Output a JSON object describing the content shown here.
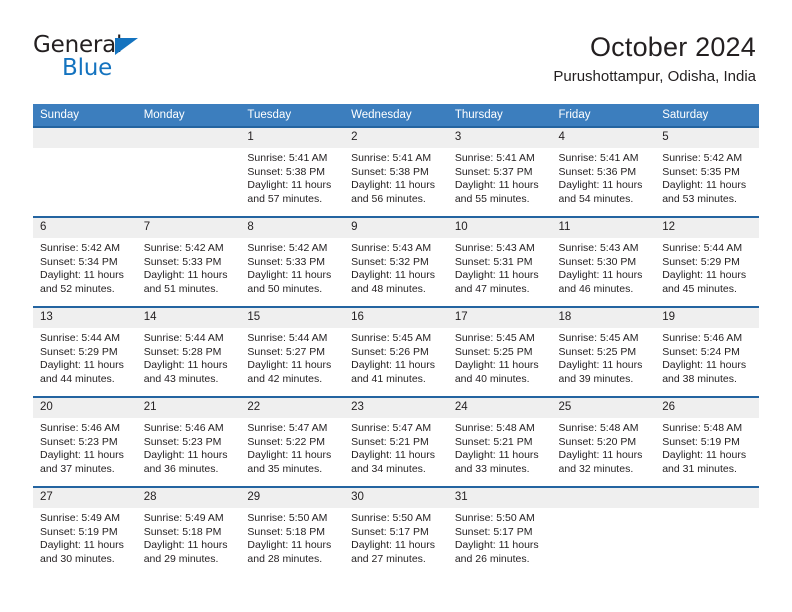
{
  "brand": {
    "name_top": "General",
    "name_bottom": "Blue"
  },
  "header": {
    "title": "October 2024",
    "location": "Purushottampur, Odisha, India"
  },
  "colors": {
    "header_blue": "#3c7ebe",
    "row_divider_blue": "#2464a0",
    "daynum_band": "#efefef",
    "brand_blue": "#1473bf",
    "text": "#231f20"
  },
  "calendar": {
    "weekday_headers": [
      "Sunday",
      "Monday",
      "Tuesday",
      "Wednesday",
      "Thursday",
      "Friday",
      "Saturday"
    ],
    "labels": {
      "sunrise_prefix": "Sunrise:",
      "sunset_prefix": "Sunset:",
      "daylight_prefix": "Daylight:"
    },
    "weeks": [
      [
        {
          "day": "",
          "sunrise": "",
          "sunset": "",
          "daylight_line1": "",
          "daylight_line2": ""
        },
        {
          "day": "",
          "sunrise": "",
          "sunset": "",
          "daylight_line1": "",
          "daylight_line2": ""
        },
        {
          "day": "1",
          "sunrise": "Sunrise: 5:41 AM",
          "sunset": "Sunset: 5:38 PM",
          "daylight_line1": "Daylight: 11 hours",
          "daylight_line2": "and 57 minutes."
        },
        {
          "day": "2",
          "sunrise": "Sunrise: 5:41 AM",
          "sunset": "Sunset: 5:38 PM",
          "daylight_line1": "Daylight: 11 hours",
          "daylight_line2": "and 56 minutes."
        },
        {
          "day": "3",
          "sunrise": "Sunrise: 5:41 AM",
          "sunset": "Sunset: 5:37 PM",
          "daylight_line1": "Daylight: 11 hours",
          "daylight_line2": "and 55 minutes."
        },
        {
          "day": "4",
          "sunrise": "Sunrise: 5:41 AM",
          "sunset": "Sunset: 5:36 PM",
          "daylight_line1": "Daylight: 11 hours",
          "daylight_line2": "and 54 minutes."
        },
        {
          "day": "5",
          "sunrise": "Sunrise: 5:42 AM",
          "sunset": "Sunset: 5:35 PM",
          "daylight_line1": "Daylight: 11 hours",
          "daylight_line2": "and 53 minutes."
        }
      ],
      [
        {
          "day": "6",
          "sunrise": "Sunrise: 5:42 AM",
          "sunset": "Sunset: 5:34 PM",
          "daylight_line1": "Daylight: 11 hours",
          "daylight_line2": "and 52 minutes."
        },
        {
          "day": "7",
          "sunrise": "Sunrise: 5:42 AM",
          "sunset": "Sunset: 5:33 PM",
          "daylight_line1": "Daylight: 11 hours",
          "daylight_line2": "and 51 minutes."
        },
        {
          "day": "8",
          "sunrise": "Sunrise: 5:42 AM",
          "sunset": "Sunset: 5:33 PM",
          "daylight_line1": "Daylight: 11 hours",
          "daylight_line2": "and 50 minutes."
        },
        {
          "day": "9",
          "sunrise": "Sunrise: 5:43 AM",
          "sunset": "Sunset: 5:32 PM",
          "daylight_line1": "Daylight: 11 hours",
          "daylight_line2": "and 48 minutes."
        },
        {
          "day": "10",
          "sunrise": "Sunrise: 5:43 AM",
          "sunset": "Sunset: 5:31 PM",
          "daylight_line1": "Daylight: 11 hours",
          "daylight_line2": "and 47 minutes."
        },
        {
          "day": "11",
          "sunrise": "Sunrise: 5:43 AM",
          "sunset": "Sunset: 5:30 PM",
          "daylight_line1": "Daylight: 11 hours",
          "daylight_line2": "and 46 minutes."
        },
        {
          "day": "12",
          "sunrise": "Sunrise: 5:44 AM",
          "sunset": "Sunset: 5:29 PM",
          "daylight_line1": "Daylight: 11 hours",
          "daylight_line2": "and 45 minutes."
        }
      ],
      [
        {
          "day": "13",
          "sunrise": "Sunrise: 5:44 AM",
          "sunset": "Sunset: 5:29 PM",
          "daylight_line1": "Daylight: 11 hours",
          "daylight_line2": "and 44 minutes."
        },
        {
          "day": "14",
          "sunrise": "Sunrise: 5:44 AM",
          "sunset": "Sunset: 5:28 PM",
          "daylight_line1": "Daylight: 11 hours",
          "daylight_line2": "and 43 minutes."
        },
        {
          "day": "15",
          "sunrise": "Sunrise: 5:44 AM",
          "sunset": "Sunset: 5:27 PM",
          "daylight_line1": "Daylight: 11 hours",
          "daylight_line2": "and 42 minutes."
        },
        {
          "day": "16",
          "sunrise": "Sunrise: 5:45 AM",
          "sunset": "Sunset: 5:26 PM",
          "daylight_line1": "Daylight: 11 hours",
          "daylight_line2": "and 41 minutes."
        },
        {
          "day": "17",
          "sunrise": "Sunrise: 5:45 AM",
          "sunset": "Sunset: 5:25 PM",
          "daylight_line1": "Daylight: 11 hours",
          "daylight_line2": "and 40 minutes."
        },
        {
          "day": "18",
          "sunrise": "Sunrise: 5:45 AM",
          "sunset": "Sunset: 5:25 PM",
          "daylight_line1": "Daylight: 11 hours",
          "daylight_line2": "and 39 minutes."
        },
        {
          "day": "19",
          "sunrise": "Sunrise: 5:46 AM",
          "sunset": "Sunset: 5:24 PM",
          "daylight_line1": "Daylight: 11 hours",
          "daylight_line2": "and 38 minutes."
        }
      ],
      [
        {
          "day": "20",
          "sunrise": "Sunrise: 5:46 AM",
          "sunset": "Sunset: 5:23 PM",
          "daylight_line1": "Daylight: 11 hours",
          "daylight_line2": "and 37 minutes."
        },
        {
          "day": "21",
          "sunrise": "Sunrise: 5:46 AM",
          "sunset": "Sunset: 5:23 PM",
          "daylight_line1": "Daylight: 11 hours",
          "daylight_line2": "and 36 minutes."
        },
        {
          "day": "22",
          "sunrise": "Sunrise: 5:47 AM",
          "sunset": "Sunset: 5:22 PM",
          "daylight_line1": "Daylight: 11 hours",
          "daylight_line2": "and 35 minutes."
        },
        {
          "day": "23",
          "sunrise": "Sunrise: 5:47 AM",
          "sunset": "Sunset: 5:21 PM",
          "daylight_line1": "Daylight: 11 hours",
          "daylight_line2": "and 34 minutes."
        },
        {
          "day": "24",
          "sunrise": "Sunrise: 5:48 AM",
          "sunset": "Sunset: 5:21 PM",
          "daylight_line1": "Daylight: 11 hours",
          "daylight_line2": "and 33 minutes."
        },
        {
          "day": "25",
          "sunrise": "Sunrise: 5:48 AM",
          "sunset": "Sunset: 5:20 PM",
          "daylight_line1": "Daylight: 11 hours",
          "daylight_line2": "and 32 minutes."
        },
        {
          "day": "26",
          "sunrise": "Sunrise: 5:48 AM",
          "sunset": "Sunset: 5:19 PM",
          "daylight_line1": "Daylight: 11 hours",
          "daylight_line2": "and 31 minutes."
        }
      ],
      [
        {
          "day": "27",
          "sunrise": "Sunrise: 5:49 AM",
          "sunset": "Sunset: 5:19 PM",
          "daylight_line1": "Daylight: 11 hours",
          "daylight_line2": "and 30 minutes."
        },
        {
          "day": "28",
          "sunrise": "Sunrise: 5:49 AM",
          "sunset": "Sunset: 5:18 PM",
          "daylight_line1": "Daylight: 11 hours",
          "daylight_line2": "and 29 minutes."
        },
        {
          "day": "29",
          "sunrise": "Sunrise: 5:50 AM",
          "sunset": "Sunset: 5:18 PM",
          "daylight_line1": "Daylight: 11 hours",
          "daylight_line2": "and 28 minutes."
        },
        {
          "day": "30",
          "sunrise": "Sunrise: 5:50 AM",
          "sunset": "Sunset: 5:17 PM",
          "daylight_line1": "Daylight: 11 hours",
          "daylight_line2": "and 27 minutes."
        },
        {
          "day": "31",
          "sunrise": "Sunrise: 5:50 AM",
          "sunset": "Sunset: 5:17 PM",
          "daylight_line1": "Daylight: 11 hours",
          "daylight_line2": "and 26 minutes."
        },
        {
          "day": "",
          "sunrise": "",
          "sunset": "",
          "daylight_line1": "",
          "daylight_line2": ""
        },
        {
          "day": "",
          "sunrise": "",
          "sunset": "",
          "daylight_line1": "",
          "daylight_line2": ""
        }
      ]
    ]
  }
}
